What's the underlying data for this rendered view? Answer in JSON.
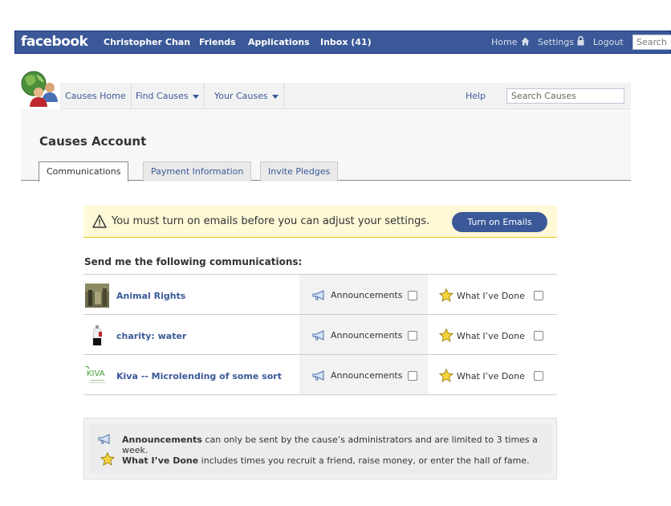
{
  "fb": {
    "logo": "facebook",
    "nav": [
      "Christopher Chan",
      "Friends",
      "Applications",
      "Inbox (41)"
    ],
    "home": "Home",
    "settings": "Settings",
    "logout": "Logout",
    "search_placeholder": "Search"
  },
  "causes_nav": {
    "home": "Causes Home",
    "find": "Find Causes",
    "yours": "Your Causes",
    "help": "Help",
    "search_placeholder": "Search Causes"
  },
  "page_title": "Causes Account",
  "tabs": [
    "Communications",
    "Payment Information",
    "Invite Pledges"
  ],
  "warning": {
    "text": "You must turn on emails before you can adjust your settings.",
    "button": "Turn on Emails"
  },
  "section_title": "Send me the following communications:",
  "causes": [
    {
      "name": "Animal Rights",
      "announcements": "Announcements",
      "what_done": "What I’ve Done"
    },
    {
      "name": "charity: water",
      "announcements": "Announcements",
      "what_done": "What I’ve Done"
    },
    {
      "name": "Kiva -- Microlending of some sort",
      "announcements": "Announcements",
      "what_done": "What I’ve Done"
    }
  ],
  "kiva_logo": "KIVA",
  "info": {
    "ann_bold": "Announcements",
    "ann_rest": " can only be sent by the cause’s administrators and are limited to 3 times a week.",
    "wid_bold": "What I’ve Done",
    "wid_rest": " includes times you recruit a friend, raise money, or enter the hall of fame."
  },
  "colors": {
    "fb_blue": "#3b5998",
    "warning_bg": "#fff9d7"
  }
}
